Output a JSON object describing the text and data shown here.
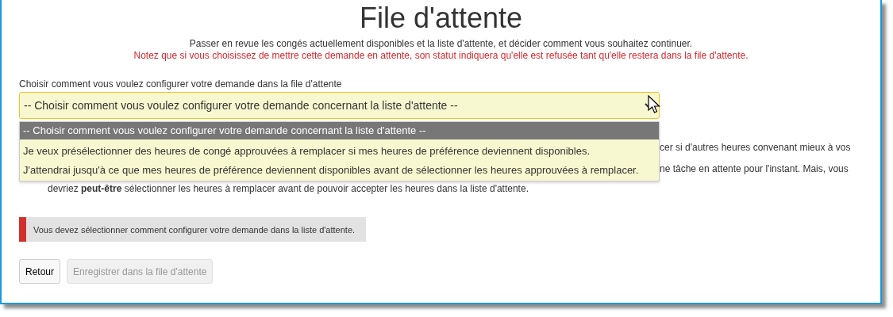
{
  "title": "File d'attente",
  "intro": "Passer en revue les congés actuellement disponibles et la liste d'attente, et décider comment vous souhaitez continuer.",
  "warning": "Notez que si vous choisissez de mettre cette demande en attente, son statut indiquera qu'elle est refusée tant qu'elle restera dans la file d'attente.",
  "select": {
    "label": "Choisir comment vous voulez configurer votre demande dans la file d'attente",
    "value": "-- Choisir comment vous voulez configurer votre demande concernant la liste d'attente --",
    "expanded": true,
    "options": [
      {
        "label": "-- Choisir comment vous voulez configurer votre demande concernant la liste d'attente --",
        "selected": true
      },
      {
        "label": "Je veux présélectionner des heures de congé approuvées à remplacer si mes heures de préférence deviennent disponibles.",
        "selected": false
      },
      {
        "label": "J'attendrai jusqu'à ce que mes heures de préférence deviennent disponibles avant de sélectionner les heures approuvées à remplacer.",
        "selected": false
      }
    ]
  },
  "background_text": [
    "cer si d'autres heures convenant mieux à vos",
    "ne tâche en attente pour l'instant. Mais, vous",
    "devriez **peut-être** sélectionner les heures à remplacer avant de pouvoir accepter les heures dans la liste d'attente."
  ],
  "error": "Vous devez sélectionner comment configurer votre demande dans la liste d'attente.",
  "buttons": [
    {
      "label": "Retour",
      "disabled": false
    },
    {
      "label": "Enregistrer dans la file d'attente",
      "disabled": true
    }
  ]
}
